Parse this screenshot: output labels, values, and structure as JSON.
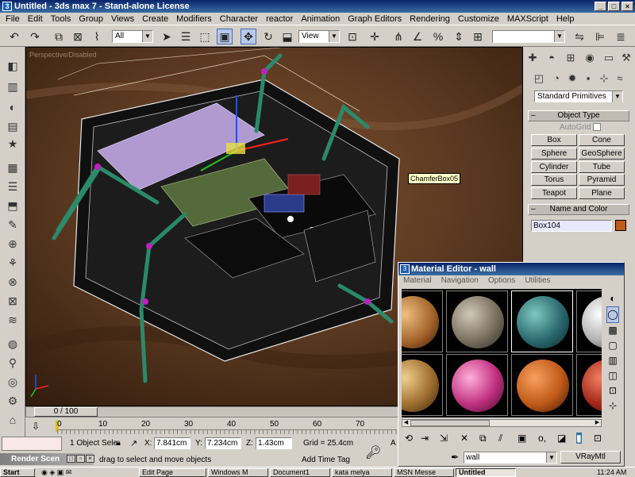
{
  "window": {
    "title": "Untitled - 3ds max 7 - Stand-alone License"
  },
  "menu": [
    "File",
    "Edit",
    "Tools",
    "Group",
    "Views",
    "Create",
    "Modifiers",
    "Character",
    "reactor",
    "Animation",
    "Graph Editors",
    "Rendering",
    "Customize",
    "MAXScript",
    "Help"
  ],
  "toolbar": {
    "selection_filter": "All",
    "ref_coord": "View",
    "named_selection": ""
  },
  "viewport": {
    "label": "Perspective/Disabled",
    "tooltip": "ChamferBox05"
  },
  "command_panel": {
    "category": "Standard Primitives",
    "object_type_title": "Object Type",
    "autogrid": "AutoGrid",
    "buttons": [
      "Box",
      "Cone",
      "Sphere",
      "GeoSphere",
      "Cylinder",
      "Tube",
      "Torus",
      "Pyramid",
      "Teapot",
      "Plane"
    ],
    "name_color_title": "Name and Color",
    "object_name": "Box104",
    "object_color": "#c05a18"
  },
  "timeline": {
    "slider_label": "0 / 100",
    "ticks": [
      "0",
      "10",
      "20",
      "30",
      "40",
      "50",
      "60",
      "70"
    ]
  },
  "status": {
    "selected": "1 Object Sele",
    "x": "7.841cm",
    "y": "7.234cm",
    "z": "1.43cm",
    "grid": "Grid = 25.4cm",
    "prompt": "drag to select and move objects",
    "add_time_tag": "Add Time Tag",
    "x_label": "X:",
    "y_label": "Y:",
    "z_label": "Z:",
    "cursor": "A"
  },
  "material_editor": {
    "title": "Material Editor - wall",
    "menu": [
      "Material",
      "Navigation",
      "Options",
      "Utilities"
    ],
    "material_name": "wall",
    "material_type": "VRayMtl"
  },
  "render_scene": "Render Scen",
  "taskbar": {
    "start": "Start",
    "tasks": [
      "Edit Page",
      "Windows M",
      "Document1",
      "kata melya",
      "MSN Messe",
      "Untitled"
    ],
    "clock": "11:24 AM"
  }
}
